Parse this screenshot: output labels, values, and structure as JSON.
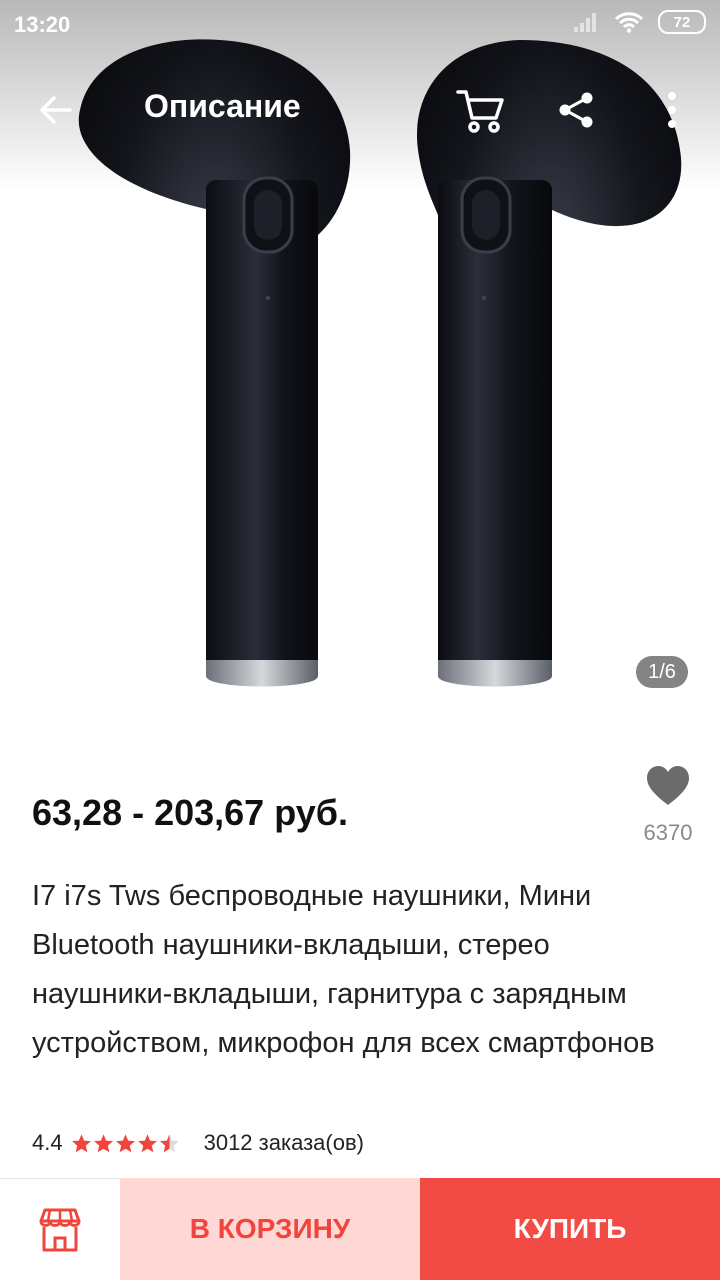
{
  "status_bar": {
    "time": "13:20",
    "battery": "72",
    "icons": [
      "signal-icon",
      "wifi-icon",
      "battery-icon"
    ]
  },
  "toolbar": {
    "title": "Описание",
    "icons": [
      "back-arrow-icon",
      "cart-icon",
      "share-icon",
      "more-vertical-icon"
    ]
  },
  "gallery": {
    "counter": "1/6",
    "image_subject": "black wireless earbuds"
  },
  "product": {
    "price": "63,28 - 203,67 руб.",
    "favorites": "6370",
    "title": "I7 i7s Tws беспроводные наушники, Мини Bluetooth наушники-вкладыши, стерео наушники-вкладыши, гарнитура с зарядным устройством, микрофон для всех смартфонов",
    "rating": "4.4",
    "rating_stars": 4.4,
    "orders": "3012 заказа(ов)"
  },
  "actions": {
    "store_icon": "store-icon",
    "add_to_cart": "В КОРЗИНУ",
    "buy": "КУПИТЬ"
  },
  "colors": {
    "accent": "#f24a44",
    "accent_light": "#ffd8d6",
    "accent_text": "#f0443c",
    "muted": "#8a8a8a"
  }
}
